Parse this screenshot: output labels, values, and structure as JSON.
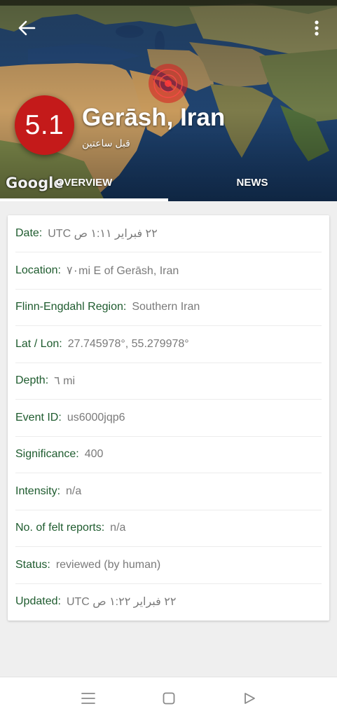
{
  "header": {
    "magnitude": "5.1",
    "place": "Gerāsh, Iran",
    "time_ago": "قبل ساعتين",
    "map_attribution": "Google",
    "tabs": [
      {
        "label": "OVERVIEW",
        "selected": true
      },
      {
        "label": "NEWS",
        "selected": false
      }
    ]
  },
  "colors": {
    "magnitude_badge": "#c41a1a",
    "label_green": "#1e5b2e",
    "value_gray": "#7a7a7a",
    "epicenter": "#d9191e"
  },
  "icons": {
    "back": "arrow-left-icon",
    "more": "more-vert-icon",
    "nav_menu": "menu-icon",
    "nav_home": "square-home-icon",
    "nav_back": "triangle-back-icon"
  },
  "details": [
    {
      "label": "Date:",
      "value": "٢٢ فبراير ١:١١ ص UTC",
      "rtl": true
    },
    {
      "label": "Location:",
      "value": "٧٠mi E of Gerāsh, Iran",
      "rtl": false
    },
    {
      "label": "Flinn-Engdahl Region:",
      "value": "Southern Iran",
      "rtl": false
    },
    {
      "label": "Lat / Lon:",
      "value": "27.745978°, 55.279978°",
      "rtl": false
    },
    {
      "label": "Depth:",
      "value": "٦ mi",
      "rtl": false
    },
    {
      "label": "Event ID:",
      "value": "us6000jqp6",
      "rtl": false
    },
    {
      "label": "Significance:",
      "value": "400",
      "rtl": false
    },
    {
      "label": "Intensity:",
      "value": "n/a",
      "rtl": false
    },
    {
      "label": "No. of felt reports:",
      "value": "n/a",
      "rtl": false
    },
    {
      "label": "Status:",
      "value": "reviewed (by human)",
      "rtl": false
    },
    {
      "label": "Updated:",
      "value": "٢٢ فبراير ١:٢٢ ص UTC",
      "rtl": true
    }
  ]
}
